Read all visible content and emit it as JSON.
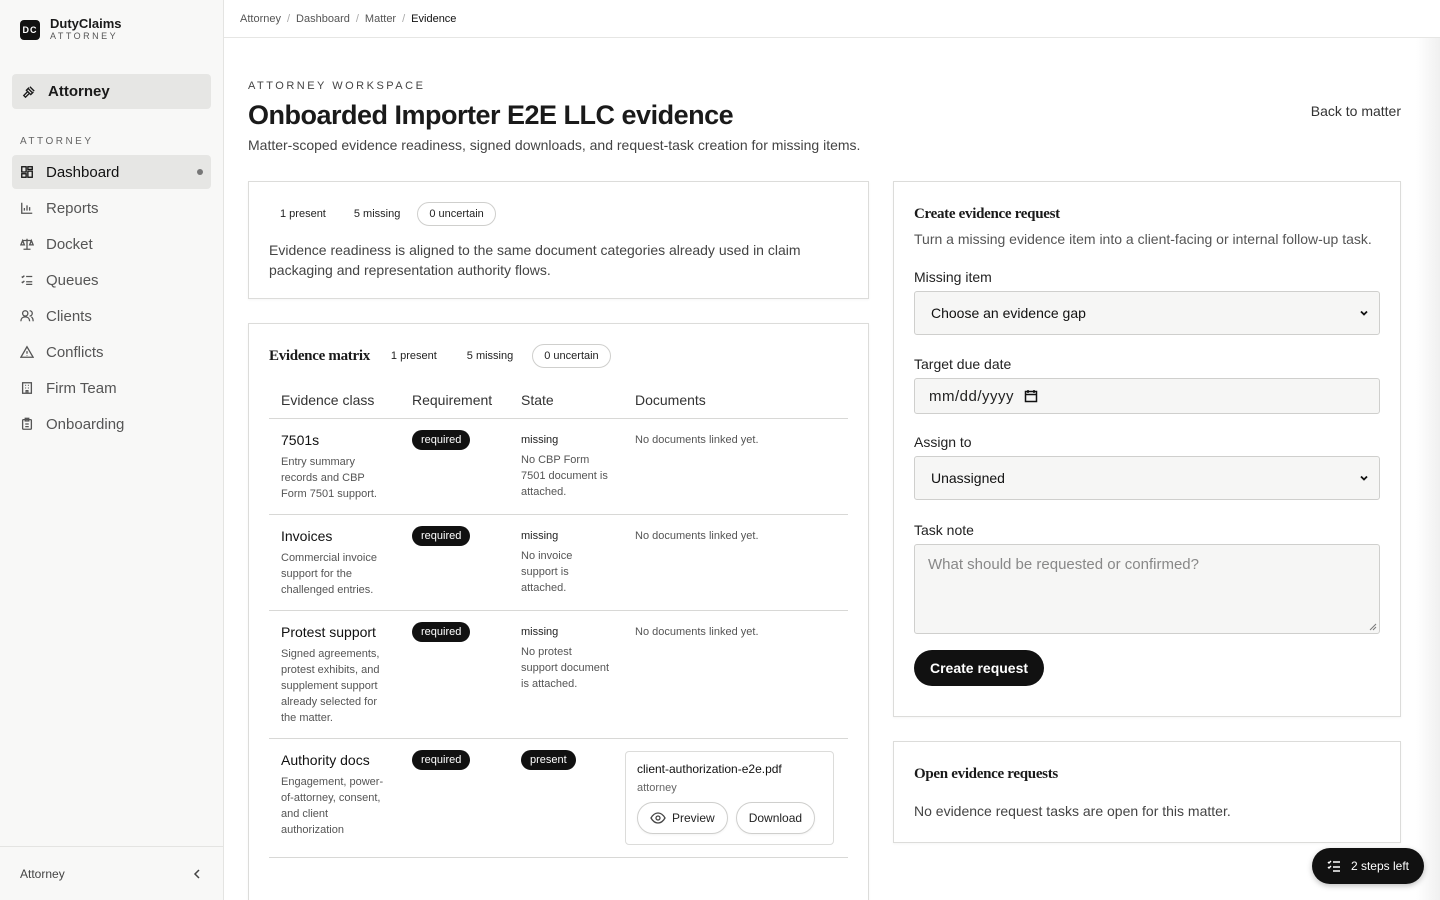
{
  "brand": {
    "logo": "DC",
    "name": "DutyClaims",
    "sub": "ATTORNEY"
  },
  "sidebar": {
    "role_switch": "Attorney",
    "section_label": "ATTORNEY",
    "items": [
      {
        "label": "Dashboard",
        "icon": "grid-icon"
      },
      {
        "label": "Reports",
        "icon": "bar-chart-icon"
      },
      {
        "label": "Docket",
        "icon": "scale-icon"
      },
      {
        "label": "Queues",
        "icon": "list-checks-icon"
      },
      {
        "label": "Clients",
        "icon": "users-icon"
      },
      {
        "label": "Conflicts",
        "icon": "warning-icon"
      },
      {
        "label": "Firm Team",
        "icon": "building-icon"
      },
      {
        "label": "Onboarding",
        "icon": "clipboard-icon"
      }
    ],
    "footer_label": "Attorney"
  },
  "breadcrumb": [
    "Attorney",
    "Dashboard",
    "Matter",
    "Evidence"
  ],
  "header": {
    "eyebrow": "ATTORNEY WORKSPACE",
    "title": "Onboarded Importer E2E LLC evidence",
    "subtitle": "Matter-scoped evidence readiness, signed downloads, and request-task creation for missing items.",
    "back_link": "Back to matter"
  },
  "summary": {
    "present": "1 present",
    "missing": "5 missing",
    "uncertain": "0 uncertain",
    "text": "Evidence readiness is aligned to the same document categories already used in claim packaging and representation authority flows."
  },
  "matrix": {
    "title": "Evidence matrix",
    "present": "1 present",
    "missing": "5 missing",
    "uncertain": "0 uncertain",
    "columns": [
      "Evidence class",
      "Requirement",
      "State",
      "Documents"
    ],
    "rows": [
      {
        "name": "7501s",
        "desc": "Entry summary records and CBP Form 7501 support.",
        "requirement": "required",
        "state": "missing",
        "state_note": "No CBP Form 7501 document is attached.",
        "documents": "No documents linked yet."
      },
      {
        "name": "Invoices",
        "desc": "Commercial invoice support for the challenged entries.",
        "requirement": "required",
        "state": "missing",
        "state_note": "No invoice support is attached.",
        "documents": "No documents linked yet."
      },
      {
        "name": "Protest support",
        "desc": "Signed agreements, protest exhibits, and supplement support already selected for the matter.",
        "requirement": "required",
        "state": "missing",
        "state_note": "No protest support document is attached.",
        "documents": "No documents linked yet."
      },
      {
        "name": "Authority docs",
        "desc": "Engagement, power-of-attorney, consent, and client authorization",
        "requirement": "required",
        "state": "present",
        "doc_name": "client-authorization-e2e.pdf",
        "doc_role": "attorney",
        "preview": "Preview",
        "download": "Download"
      }
    ]
  },
  "request_form": {
    "title": "Create evidence request",
    "subtitle": "Turn a missing evidence item into a client-facing or internal follow-up task.",
    "missing_label": "Missing item",
    "missing_value": "Choose an evidence gap",
    "due_label": "Target due date",
    "due_placeholder": "mm/dd/yyyy",
    "assign_label": "Assign to",
    "assign_value": "Unassigned",
    "note_label": "Task note",
    "note_placeholder": "What should be requested or confirmed?",
    "submit": "Create request"
  },
  "open_requests": {
    "title": "Open evidence requests",
    "empty": "No evidence request tasks are open for this matter."
  },
  "steps_badge": "2 steps left"
}
